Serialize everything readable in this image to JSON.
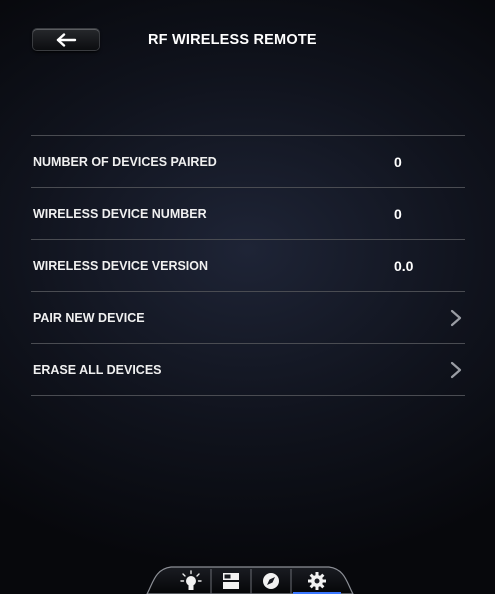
{
  "header": {
    "back_icon": "arrow-left-icon",
    "title": "RF WIRELESS REMOTE"
  },
  "rows": [
    {
      "label": "NUMBER OF DEVICES PAIRED",
      "value": "0"
    },
    {
      "label": "WIRELESS DEVICE NUMBER",
      "value": "0"
    },
    {
      "label": "WIRELESS DEVICE VERSION",
      "value": "0.0"
    },
    {
      "label": "PAIR NEW DEVICE",
      "value": null,
      "icon": "chevron-right-icon"
    },
    {
      "label": "ERASE ALL DEVICES",
      "value": null,
      "icon": "chevron-right-icon"
    }
  ],
  "tabbar": {
    "tabs": [
      {
        "icon": "lightbulb-icon"
      },
      {
        "icon": "layout-panels-icon"
      },
      {
        "icon": "compass-icon"
      },
      {
        "icon": "gear-icon",
        "active": true
      }
    ]
  },
  "colors": {
    "background": "#10131d",
    "divider": "#4a4c52",
    "text": "#ffffff",
    "active_tab": "#3b78ff"
  }
}
